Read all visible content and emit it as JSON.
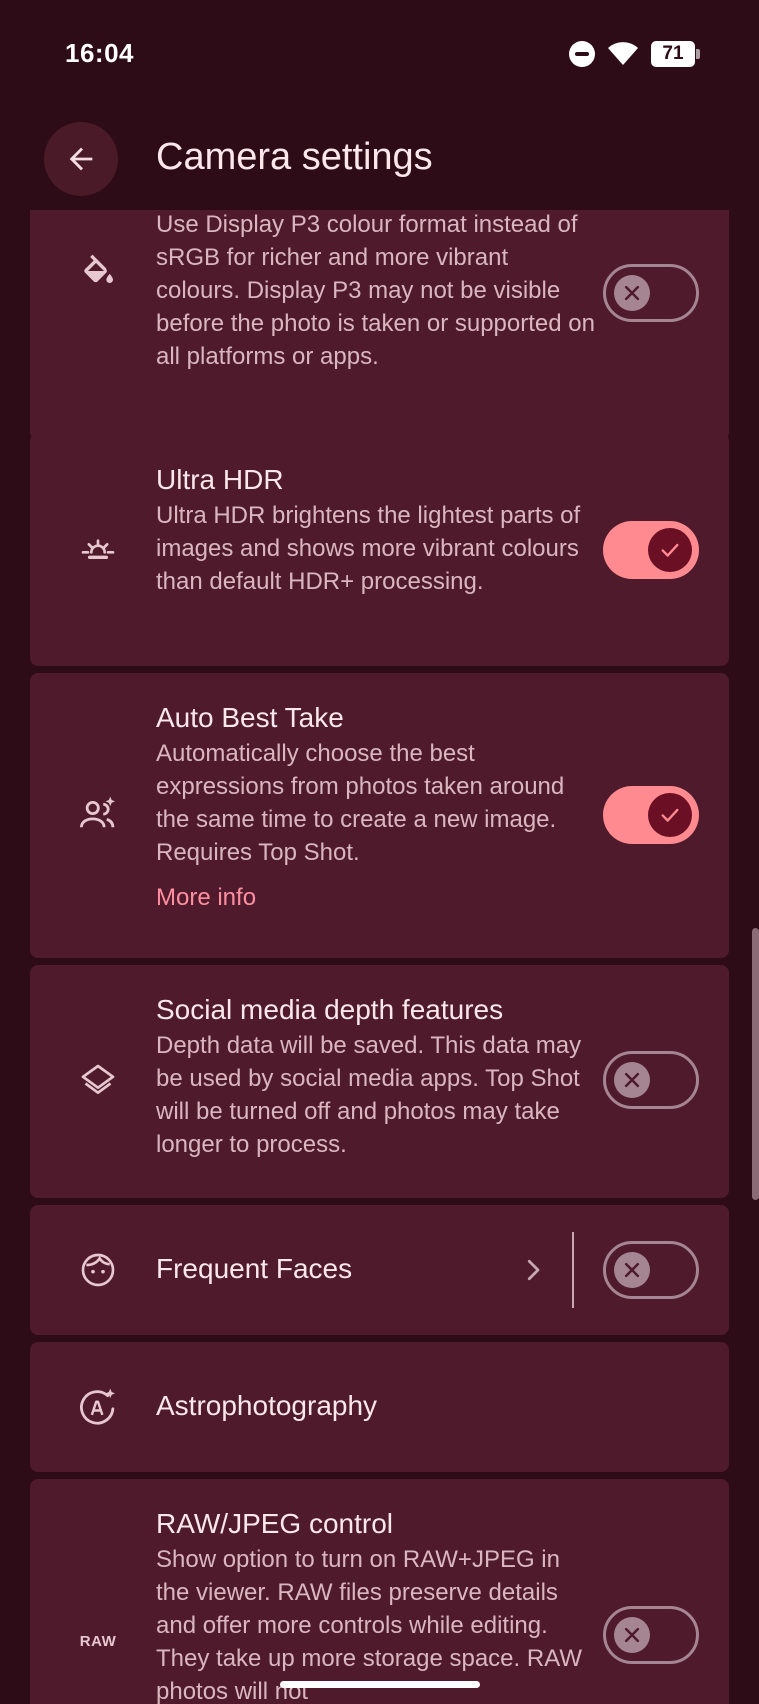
{
  "status_bar": {
    "time": "16:04",
    "battery": "71"
  },
  "header": {
    "title": "Camera settings"
  },
  "settings": {
    "p3": {
      "description": "Use Display P3 colour format instead of sRGB for richer and more vibrant colours. Display P3 may not be visible before the photo is taken or supported on all platforms or apps.",
      "enabled": false,
      "icon": "paint-bucket-icon"
    },
    "ultra_hdr": {
      "title": "Ultra HDR",
      "description": "Ultra HDR brightens the lightest parts of images and shows more vibrant colours than default HDR+ processing.",
      "enabled": true,
      "icon": "sunrise-icon"
    },
    "auto_best_take": {
      "title": "Auto Best Take",
      "description": "Automatically choose the best expressions from photos taken around the same time to create a new image. Requires Top Shot.",
      "link": "More info",
      "enabled": true,
      "icon": "people-sparkle-icon"
    },
    "social_depth": {
      "title": "Social media depth features",
      "description": "Depth data will be saved. This data may be used by social media apps. Top Shot will be turned off and photos may take longer to process.",
      "enabled": false,
      "icon": "layers-icon"
    },
    "frequent_faces": {
      "title": "Frequent Faces",
      "enabled": false,
      "icon": "face-icon"
    },
    "astrophotography": {
      "title": "Astrophotography",
      "icon": "astro-auto-icon"
    },
    "raw_jpeg": {
      "title": "RAW/JPEG control",
      "description": "Show option to turn on RAW+JPEG in the viewer. RAW files preserve details and offer more controls while editing. They take up more storage space. RAW photos will not",
      "icon_label": "RAW",
      "enabled": false
    }
  },
  "colors": {
    "background": "#2e0c17",
    "card": "#4e1a2c",
    "accent": "#ff8a90",
    "link": "#ff8fa0"
  }
}
